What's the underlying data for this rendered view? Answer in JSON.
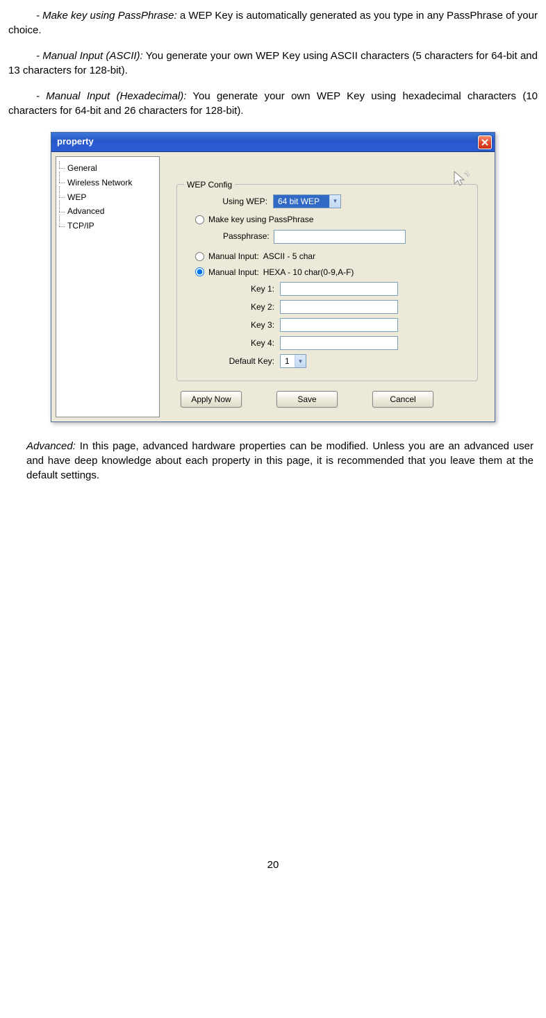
{
  "doc": {
    "p1_italic": "- Make key using PassPhrase:",
    "p1_rest": " a WEP Key is automatically generated as you type in any PassPhrase of your choice.",
    "p2_italic": "- Manual Input (ASCII):",
    "p2_rest": " You generate your own WEP Key using ASCII characters (5 characters for 64-bit and 13 characters for 128-bit).",
    "p3_italic": "- Manual Input (Hexadecimal):",
    "p3_rest": " You generate your own WEP Key using hexadecimal characters (10 characters for 64-bit and 26 characters for 128-bit).",
    "after_italic": "Advanced:",
    "after_rest": " In this page, advanced hardware properties can be modified. Unless you are an advanced user and have deep knowledge about each property in this page, it is recommended that you leave them at the default settings.",
    "page_number": "20"
  },
  "dialog": {
    "title": "property",
    "sidebar": {
      "items": [
        "General",
        "Wireless Network",
        "WEP",
        "Advanced",
        "TCP/IP"
      ]
    },
    "content": {
      "legend": "WEP Config",
      "using_wep_label": "Using WEP:",
      "using_wep_value": "64 bit WEP",
      "radio_passphrase": "Make key using PassPhrase",
      "passphrase_label": "Passphrase:",
      "radio_ascii_label": "Manual Input:",
      "radio_ascii_desc": "ASCII - 5 char",
      "radio_hexa_label": "Manual Input:",
      "radio_hexa_desc": "HEXA - 10 char(0-9,A-F)",
      "key1": "Key 1:",
      "key2": "Key 2:",
      "key3": "Key 3:",
      "key4": "Key 4:",
      "default_key_label": "Default Key:",
      "default_key_value": "1",
      "btn_apply": "Apply Now",
      "btn_save": "Save",
      "btn_cancel": "Cancel"
    }
  }
}
